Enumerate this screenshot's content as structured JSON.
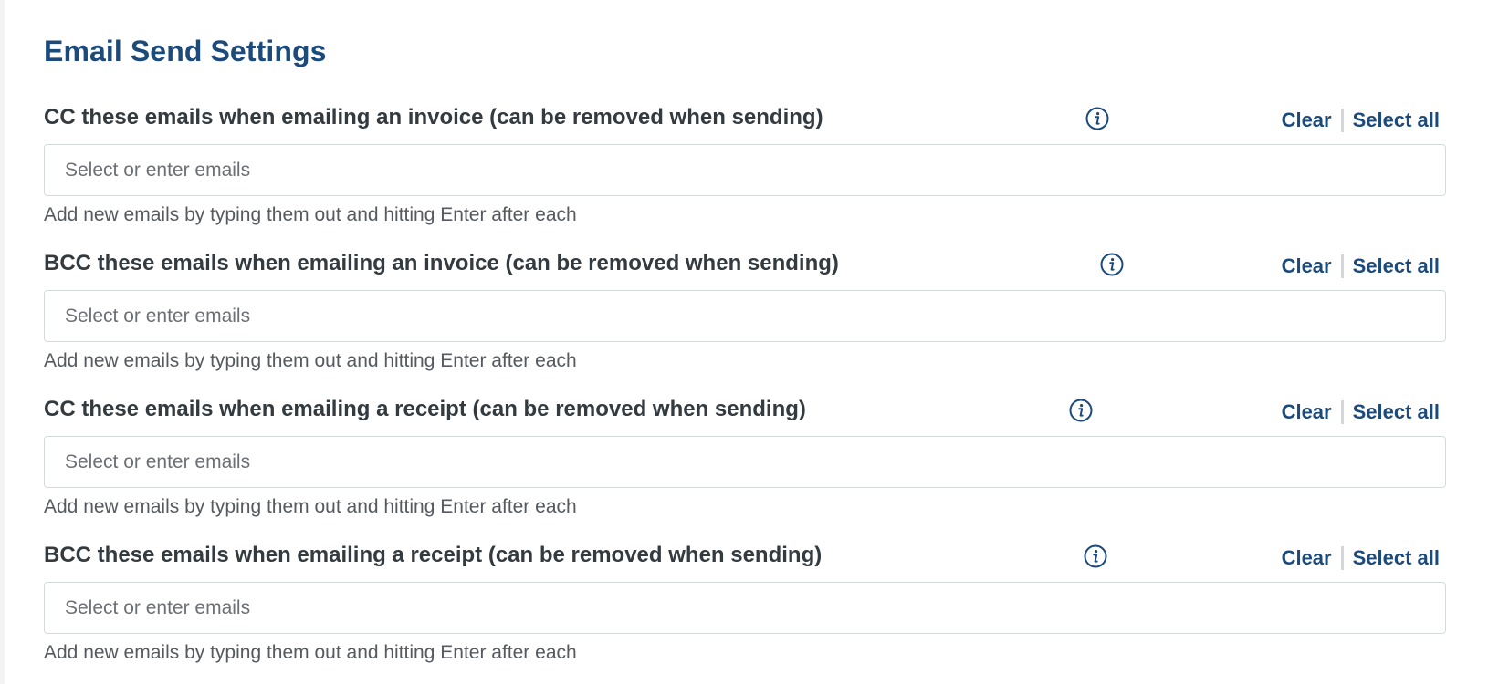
{
  "page": {
    "title": "Email Send Settings"
  },
  "colors": {
    "heading": "#1c4a7a",
    "label": "#333a40",
    "link": "#1c4a7a",
    "border": "#d7dadd",
    "help_text": "#555a5f"
  },
  "fields": [
    {
      "label": "CC these emails when emailing an invoice (can be removed when sending)",
      "info_icon": "info-circle-icon",
      "clear_label": "Clear",
      "select_all_label": "Select all",
      "value": "",
      "placeholder": "Select or enter emails",
      "help": "Add new emails by typing them out and hitting Enter after each"
    },
    {
      "label": "BCC these emails when emailing an invoice (can be removed when sending)",
      "info_icon": "info-circle-icon",
      "clear_label": "Clear",
      "select_all_label": "Select all",
      "value": "",
      "placeholder": "Select or enter emails",
      "help": "Add new emails by typing them out and hitting Enter after each"
    },
    {
      "label": "CC these emails when emailing a receipt (can be removed when sending)",
      "info_icon": "info-circle-icon",
      "clear_label": "Clear",
      "select_all_label": "Select all",
      "value": "",
      "placeholder": "Select or enter emails",
      "help": "Add new emails by typing them out and hitting Enter after each"
    },
    {
      "label": "BCC these emails when emailing a receipt (can be removed when sending)",
      "info_icon": "info-circle-icon",
      "clear_label": "Clear",
      "select_all_label": "Select all",
      "value": "",
      "placeholder": "Select or enter emails",
      "help": "Add new emails by typing them out and hitting Enter after each"
    }
  ]
}
